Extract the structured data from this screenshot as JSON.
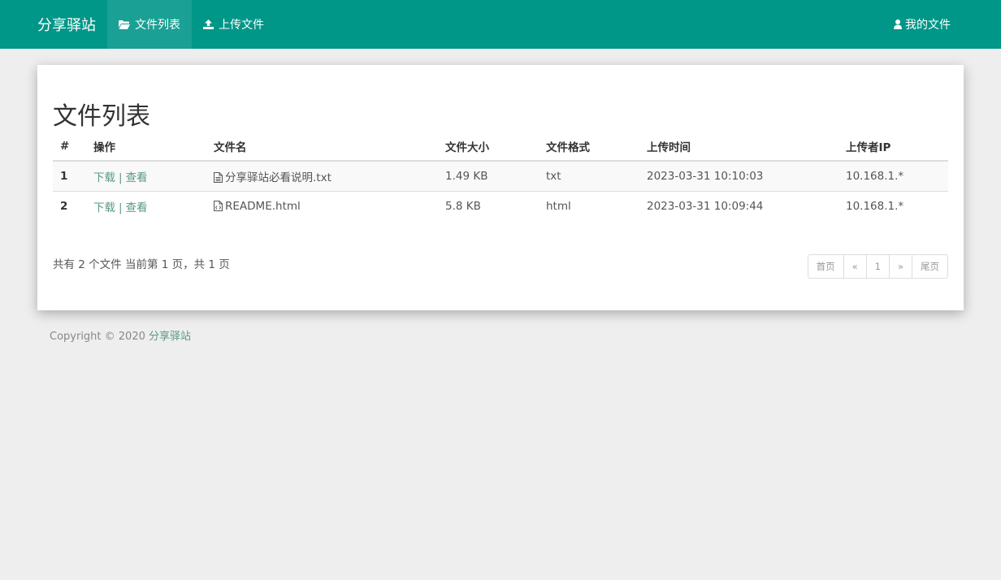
{
  "navbar": {
    "brand": "分享驿站",
    "items": [
      {
        "label": "文件列表",
        "icon": "folder-open-icon",
        "active": true
      },
      {
        "label": "上传文件",
        "icon": "upload-icon",
        "active": false
      }
    ],
    "right": {
      "label": "我的文件",
      "icon": "user-icon"
    },
    "color": "#009688"
  },
  "main": {
    "title": "文件列表",
    "table": {
      "headers": [
        "#",
        "操作",
        "文件名",
        "文件大小",
        "文件格式",
        "上传时间",
        "上传者IP"
      ],
      "rows": [
        {
          "num": "1",
          "download": "下载",
          "sep": "|",
          "view": "查看",
          "file_icon": "text-file-icon",
          "name": "分享驿站必看说明.txt",
          "size": "1.49 KB",
          "format": "txt",
          "time": "2023-03-31 10:10:03",
          "ip": "10.168.1.*"
        },
        {
          "num": "2",
          "download": "下载",
          "sep": "|",
          "view": "查看",
          "file_icon": "code-file-icon",
          "name": "README.html",
          "size": "5.8 KB",
          "format": "html",
          "time": "2023-03-31 10:09:44",
          "ip": "10.168.1.*"
        }
      ]
    },
    "summary": "共有 2 个文件  当前第 1 页，共 1 页",
    "pagination": [
      "首页",
      "«",
      "1",
      "»",
      "尾页"
    ]
  },
  "footer": {
    "text": "Copyright © 2020 ",
    "link": "分享驿站"
  }
}
